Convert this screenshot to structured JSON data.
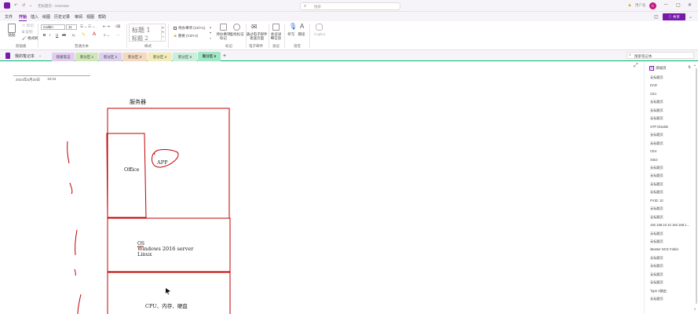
{
  "titlebar": {
    "doc_title": "无标题页",
    "app_name": "OneNote",
    "search_placeholder": "搜索",
    "user": "用户名",
    "avatar_initial": "C",
    "minimize": "─",
    "maximize": "▢",
    "close": "✕"
  },
  "ribbon_tabs": [
    "文件",
    "开始",
    "插入",
    "绘图",
    "历史记录",
    "审阅",
    "视图",
    "帮助"
  ],
  "active_tab": "开始",
  "share_label": "⇧ 共享",
  "ribbon": {
    "clipboard": {
      "paste": "粘贴",
      "cut": "剪切",
      "copy": "复制",
      "format_painter": "格式刷",
      "group": "剪贴板"
    },
    "basic_text": {
      "font": "Calibri",
      "size": "11",
      "bold": "B",
      "italic": "I",
      "underline": "U",
      "strike": "ab",
      "group": "普通文本"
    },
    "styles": {
      "heading1": "标题 1",
      "heading2": "标题 2",
      "group": "样式"
    },
    "tags": {
      "todo": "待办事项 (Ctrl+1)",
      "important": "重要 (Ctrl+2)",
      "todo_tag": "待办事项标记",
      "find_tags": "查找标记",
      "group": "标记"
    },
    "email": {
      "label": "通过电子邮件发送页面",
      "group": "电子邮件"
    },
    "meetings": {
      "label": "会议详细信息",
      "group": "会议"
    },
    "voice": {
      "dictate": "听写",
      "read": "朗读",
      "group": "语音"
    },
    "copilot": "Copilot"
  },
  "notebook": {
    "name": "我的笔记本",
    "sections": [
      {
        "label": "快速笔记",
        "color": "#e1cdf0"
      },
      {
        "label": "新分区 1",
        "color": "#cfe8b8"
      },
      {
        "label": "新分区 2",
        "color": "#ddd0ee"
      },
      {
        "label": "新分区 3",
        "color": "#f5d8c0"
      },
      {
        "label": "新分区 4",
        "color": "#f2edb8"
      },
      {
        "label": "新分区 5",
        "color": "#c9eeda"
      },
      {
        "label": "新分区 6",
        "color": "#9ee8c6"
      }
    ],
    "active_section": "新分区 6",
    "add_section": "+",
    "search_placeholder": "搜索笔记本"
  },
  "page": {
    "date": "2024年6月20日",
    "time": "19:34"
  },
  "ink_labels": {
    "server": "服务器",
    "office": "Office",
    "app": "APP",
    "os": "OS",
    "windows": "Windows 2016 server",
    "linux": "Linux",
    "hardware": "CPU、内存、硬盘"
  },
  "pagelist": {
    "add_page": "添加页",
    "pages": [
      "无标题页",
      "DAD",
      "CE1",
      "无标题页",
      "无标题页",
      "无标题页",
      "STP Disable",
      "无标题页",
      "无标题页",
      "CE4",
      "Site2",
      "无标题页",
      "无标题页",
      "无标题页",
      "无标题页",
      "PVID: 10",
      "无标题页",
      "无标题页",
      "192.168.10.10 192.168.1...",
      "无标题页",
      "无标题页",
      "iMaster NCE Fabric",
      "无标题页",
      "无标题页",
      "无标题页",
      "无标题页",
      "Type 2路由",
      "无标题页"
    ]
  },
  "colors": {
    "accent": "#7719aa",
    "ink_red": "#c00000",
    "section_bar": "#00b871"
  }
}
